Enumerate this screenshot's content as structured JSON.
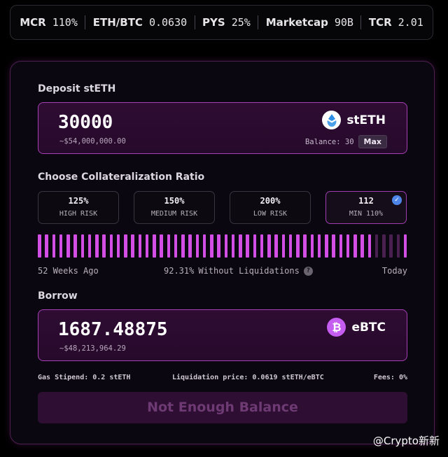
{
  "stats": [
    {
      "key": "MCR",
      "value": "110%"
    },
    {
      "key": "ETH/BTC",
      "value": "0.0630"
    },
    {
      "key": "PYS",
      "value": "25%"
    },
    {
      "key": "Marketcap",
      "value": "90B"
    },
    {
      "key": "TCR",
      "value": "2.01"
    }
  ],
  "deposit": {
    "title": "Deposit stETH",
    "amount": "30000",
    "usd_value": "~$54,000,000.00",
    "token": "stETH",
    "balance_label": "Balance: 30",
    "max_label": "Max"
  },
  "collateral": {
    "title": "Choose Collateralization Ratio",
    "options": [
      {
        "value": "125%",
        "label": "HIGH RISK"
      },
      {
        "value": "150%",
        "label": "MEDIUM RISK"
      },
      {
        "value": "200%",
        "label": "LOW RISK"
      },
      {
        "value": "112",
        "label": "MIN 110%",
        "selected": true
      }
    ]
  },
  "history": {
    "bar_count": 52,
    "without_liquidation_fraction": 0.9231,
    "active_color": "#d34ee4",
    "inactive_color": "#4a2050",
    "start_label": "52 Weeks Ago",
    "percent": "92.31%",
    "middle_label": "Without Liquidations",
    "end_label": "Today"
  },
  "borrow": {
    "title": "Borrow",
    "amount": "1687.48875",
    "usd_value": "~$48,213,964.29",
    "token": "eBTC"
  },
  "footer": {
    "gas_stipend": "Gas Stipend: 0.2 stETH",
    "liquidation_price": "Liquidation price: 0.0619 stETH/eBTC",
    "fees": "Fees: 0%"
  },
  "submit_label": "Not Enough Balance",
  "watermark": "@Crypto新新",
  "colors": {
    "accent": "#c13ed6",
    "panel_bg": "#0b0710",
    "input_bg": "#2f0c33"
  }
}
